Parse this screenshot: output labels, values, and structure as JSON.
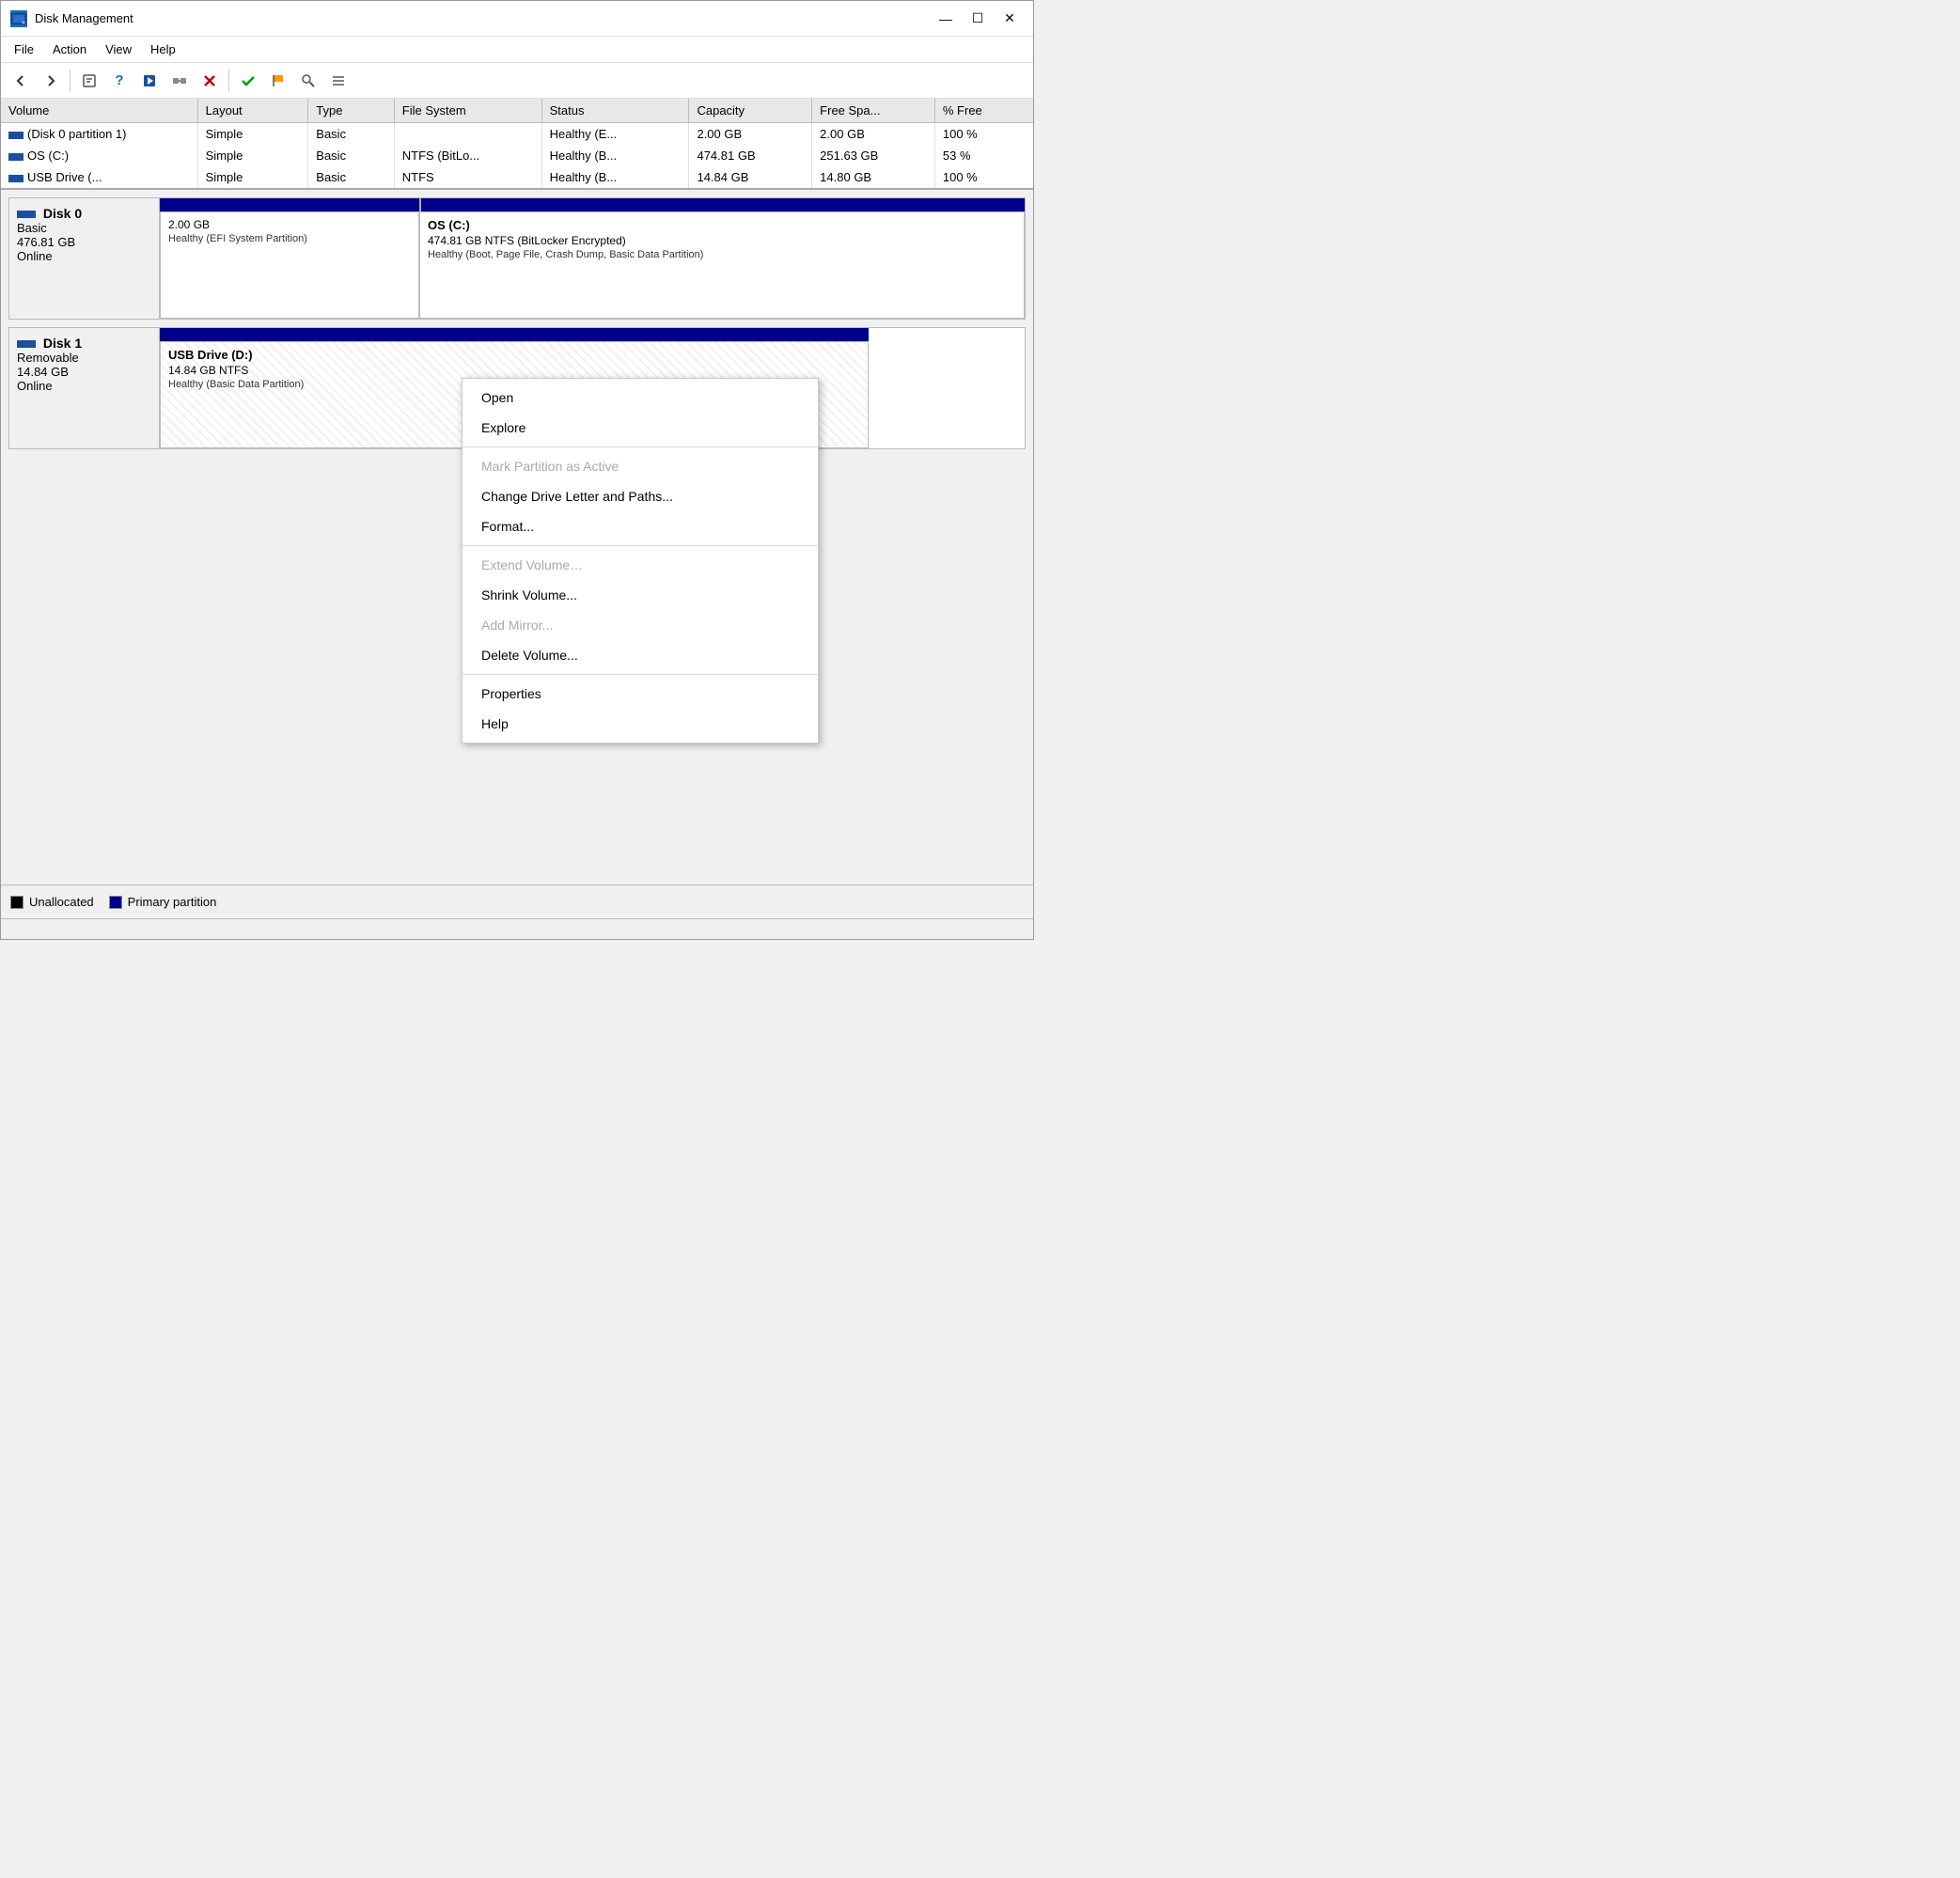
{
  "window": {
    "title": "Disk Management",
    "icon": "💾",
    "controls": {
      "minimize": "—",
      "maximize": "☐",
      "close": "✕"
    }
  },
  "menu": {
    "items": [
      "File",
      "Action",
      "View",
      "Help"
    ]
  },
  "toolbar": {
    "buttons": [
      "←",
      "→",
      "⊞",
      "?",
      "▶",
      "🔍",
      "✕",
      "✓",
      "🔖",
      "🔍",
      "≡"
    ]
  },
  "table": {
    "columns": [
      "Volume",
      "Layout",
      "Type",
      "File System",
      "Status",
      "Capacity",
      "Free Spa...",
      "% Free"
    ],
    "rows": [
      {
        "volume": "(Disk 0 partition 1)",
        "layout": "Simple",
        "type": "Basic",
        "filesystem": "",
        "status": "Healthy (E...",
        "capacity": "2.00 GB",
        "free_space": "2.00 GB",
        "percent_free": "100 %"
      },
      {
        "volume": "OS (C:)",
        "layout": "Simple",
        "type": "Basic",
        "filesystem": "NTFS (BitLo...",
        "status": "Healthy (B...",
        "capacity": "474.81 GB",
        "free_space": "251.63 GB",
        "percent_free": "53 %"
      },
      {
        "volume": "USB Drive (...",
        "layout": "Simple",
        "type": "Basic",
        "filesystem": "NTFS",
        "status": "Healthy (B...",
        "capacity": "14.84 GB",
        "free_space": "14.80 GB",
        "percent_free": "100 %"
      }
    ]
  },
  "disks": [
    {
      "name": "Disk 0",
      "type": "Basic",
      "size": "476.81 GB",
      "status": "Online",
      "bar": [
        {
          "width": "30%",
          "color": "dark-blue"
        },
        {
          "width": "70%",
          "color": "dark-blue"
        }
      ],
      "partitions": [
        {
          "width": "30%",
          "name": "",
          "size": "2.00 GB",
          "info": "Healthy (EFI System Partition)",
          "type": "primary"
        },
        {
          "width": "70%",
          "name": "OS  (C:)",
          "size": "474.81 GB NTFS (BitLocker Encrypted)",
          "info": "Healthy (Boot, Page File, Crash Dump, Basic Data Partition)",
          "type": "primary"
        }
      ]
    },
    {
      "name": "Disk 1",
      "type": "Removable",
      "size": "14.84 GB",
      "status": "Online",
      "bar": [
        {
          "width": "100%",
          "color": "dark-blue"
        }
      ],
      "partitions": [
        {
          "width": "100%",
          "name": "USB Drive  (D:)",
          "size": "14.84 GB NTFS",
          "info": "Healthy (Basic Data Partition)",
          "type": "usb"
        }
      ]
    }
  ],
  "context_menu": {
    "items": [
      {
        "label": "Open",
        "enabled": true,
        "separator_after": false
      },
      {
        "label": "Explore",
        "enabled": true,
        "separator_after": true
      },
      {
        "label": "Mark Partition as Active",
        "enabled": false,
        "separator_after": false
      },
      {
        "label": "Change Drive Letter and Paths...",
        "enabled": true,
        "separator_after": false
      },
      {
        "label": "Format...",
        "enabled": true,
        "separator_after": true
      },
      {
        "label": "Extend Volume…",
        "enabled": false,
        "separator_after": false
      },
      {
        "label": "Shrink Volume...",
        "enabled": true,
        "separator_after": false
      },
      {
        "label": "Add Mirror...",
        "enabled": false,
        "separator_after": false
      },
      {
        "label": "Delete Volume...",
        "enabled": true,
        "separator_after": true
      },
      {
        "label": "Properties",
        "enabled": true,
        "separator_after": false
      },
      {
        "label": "Help",
        "enabled": true,
        "separator_after": false
      }
    ]
  },
  "legend": {
    "items": [
      {
        "label": "Unallocated",
        "color": "black"
      },
      {
        "label": "Primary partition",
        "color": "blue"
      }
    ]
  }
}
